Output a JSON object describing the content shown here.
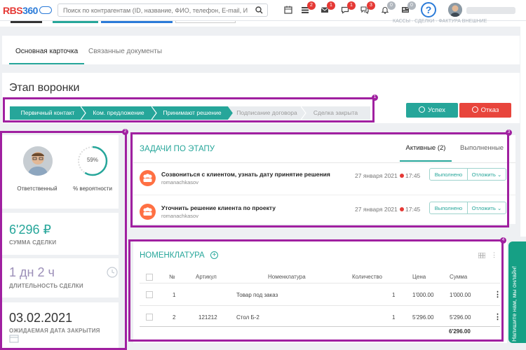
{
  "header": {
    "logo_text": "RBS",
    "logo_num": "360",
    "search_placeholder": "Поиск по контрагентам (ID, название, ФИО, телефон, E-mail, ИНН)...",
    "icons": [
      {
        "name": "calendar-icon",
        "badge": ""
      },
      {
        "name": "list-icon",
        "badge": "2"
      },
      {
        "name": "mail-icon",
        "badge": "1"
      },
      {
        "name": "chat-icon",
        "badge": "1"
      },
      {
        "name": "comments-icon",
        "badge": "3"
      },
      {
        "name": "bell-icon",
        "badge": "0"
      },
      {
        "name": "news-icon",
        "badge": "0"
      }
    ],
    "help_label": "?"
  },
  "top_strip": {
    "links": "КАССЫ · СДЕЛКИ · ФАКТУРА ВНЕШНИЕ"
  },
  "tabs": [
    {
      "label": "Основная карточка",
      "active": true
    },
    {
      "label": "Связанные документы",
      "active": false
    }
  ],
  "funnel": {
    "title": "Этап воронки",
    "stages": [
      {
        "label": "Первичный контакт",
        "state": "done"
      },
      {
        "label": "Ком. предложение",
        "state": "done"
      },
      {
        "label": "Принимают решение",
        "state": "done"
      },
      {
        "label": "Подписание договора",
        "state": "pending"
      },
      {
        "label": "Сделка закрыта",
        "state": "pending"
      }
    ],
    "success_label": "Успех",
    "refuse_label": "Отказ",
    "colors": {
      "done": "#26a69a",
      "pending": "#e9ecef"
    }
  },
  "deal": {
    "responsible_label": "Ответственный",
    "probability": "59%",
    "probability_fraction": 0.59,
    "probability_label": "% вероятности",
    "amount": "6'296 ₽",
    "amount_label": "СУММА СДЕЛКИ",
    "duration": "1 дн 2 ч",
    "duration_label": "ДЛИТЕЛЬНОСТЬ СДЕЛКИ",
    "close_date": "03.02.2021",
    "close_date_label": "ОЖИДАЕМАЯ ДАТА ЗАКРЫТИЯ"
  },
  "tasks": {
    "title": "ЗАДАЧИ ПО ЭТАПУ",
    "tab_active": "Активные (2)",
    "tab_done": "Выполненные",
    "items": [
      {
        "title": "Созвониться с клиентом, узнать дату принятие решения",
        "user": "romanachkasov",
        "date": "27 января 2021",
        "time": "17:45",
        "done_label": "Выполнено",
        "defer_label": "Отложить"
      },
      {
        "title": "Уточнить решение клиента по проекту",
        "user": "romanachkasov",
        "date": "27 января 2021",
        "time": "17:45",
        "done_label": "Выполнено",
        "defer_label": "Отложить"
      }
    ]
  },
  "nomenclature": {
    "title": "НОМЕНКЛАТУРА",
    "columns": [
      "№",
      "Артикул",
      "Номенклатура",
      "Количество",
      "Цена",
      "Сумма"
    ],
    "rows": [
      {
        "n": "1",
        "article": "",
        "name": "Товар под заказ",
        "qty": "1",
        "price": "1'000.00",
        "sum": "1'000.00"
      },
      {
        "n": "2",
        "article": "121212",
        "name": "Стол Б-2",
        "qty": "1",
        "price": "5'296.00",
        "sum": "5'296.00"
      }
    ],
    "total": "6'296.00"
  },
  "chat_widget": {
    "label": "Напишите нам, мы онлайн!"
  },
  "annotations": [
    "1",
    "2",
    "3",
    "4"
  ]
}
